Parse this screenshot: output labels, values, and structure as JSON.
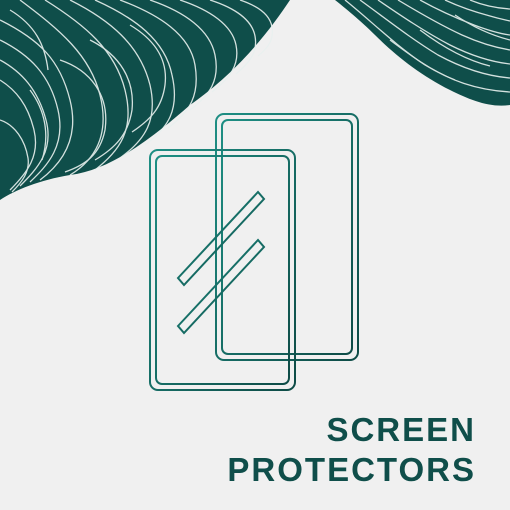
{
  "caption": {
    "line1": "SCREEN",
    "line2": "PROTECTORS"
  },
  "colors": {
    "background": "#f0f0f0",
    "accent_dark": "#0f4e4a",
    "accent_light": "#1f8c80",
    "pattern_line": "#e9f1ef"
  },
  "icons": {
    "main": "screen-protector-icon",
    "decoration": "wavy-line-pattern"
  }
}
